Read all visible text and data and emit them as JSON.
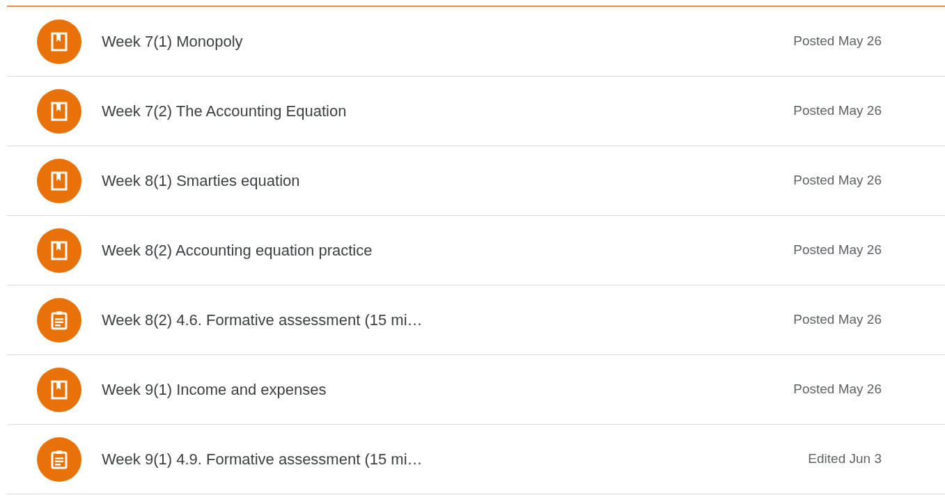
{
  "items": [
    {
      "kind": "material",
      "title": "Week 7(1) Monopoly",
      "date": "Posted May 26"
    },
    {
      "kind": "material",
      "title": "Week 7(2) The Accounting Equation",
      "date": "Posted May 26"
    },
    {
      "kind": "material",
      "title": "Week 8(1) Smarties equation",
      "date": "Posted May 26"
    },
    {
      "kind": "material",
      "title": "Week 8(2) Accounting equation practice",
      "date": "Posted May 26"
    },
    {
      "kind": "assignment",
      "title": "Week 8(2) 4.6. Formative assessment (15 mi…",
      "date": "Posted May 26"
    },
    {
      "kind": "material",
      "title": "Week 9(1) Income and expenses",
      "date": "Posted May 26"
    },
    {
      "kind": "assignment",
      "title": "Week 9(1) 4.9. Formative assessment (15 mi…",
      "date": "Edited Jun 3"
    }
  ]
}
